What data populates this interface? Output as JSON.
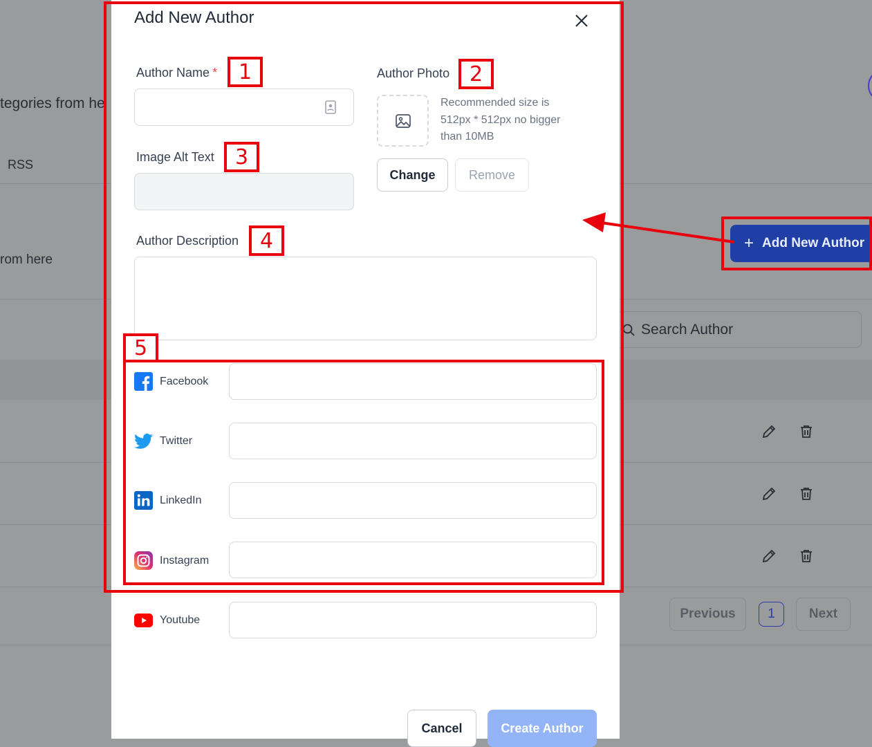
{
  "background": {
    "fragment_categories": "tegories from he",
    "fragment_rss": "RSS",
    "fragment_from_here": "rom here",
    "add_button_label": "Add New Author",
    "search_placeholder": "Search Author",
    "pager": {
      "previous": "Previous",
      "current": "1",
      "next": "Next"
    }
  },
  "modal": {
    "title": "Add New Author",
    "author_name": {
      "label": "Author Name",
      "required_mark": "*",
      "value": ""
    },
    "author_photo": {
      "label": "Author Photo",
      "hint": "Recommended size is 512px * 512px no bigger than 10MB",
      "change_label": "Change",
      "remove_label": "Remove"
    },
    "image_alt_text": {
      "label": "Image Alt Text",
      "value": ""
    },
    "author_description": {
      "label": "Author Description",
      "value": ""
    },
    "social": [
      {
        "name": "Facebook",
        "value": ""
      },
      {
        "name": "Twitter",
        "value": ""
      },
      {
        "name": "LinkedIn",
        "value": ""
      },
      {
        "name": "Instagram",
        "value": ""
      },
      {
        "name": "Youtube",
        "value": ""
      }
    ],
    "cancel_label": "Cancel",
    "create_label": "Create Author"
  },
  "annotations": [
    "1",
    "2",
    "3",
    "4",
    "5"
  ],
  "colors": {
    "annotation_red": "#e8000d",
    "primary_blue": "#1f3fa6",
    "create_disabled": "#93b4f6",
    "overlay_gray": "#9a9b9d"
  }
}
